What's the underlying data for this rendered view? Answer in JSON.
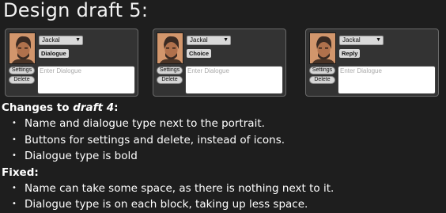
{
  "title": "Design draft 5:",
  "cards": [
    {
      "name": "Jackal",
      "dialogue_type": "Dialogue",
      "settings_label": "Settings",
      "delete_label": "Delete",
      "dialogue_placeholder": "Enter Dialogue"
    },
    {
      "name": "Jackal",
      "dialogue_type": "Choice",
      "settings_label": "Settings",
      "delete_label": "Delete",
      "dialogue_placeholder": "Enter Dialogue"
    },
    {
      "name": "Jackal",
      "dialogue_type": "Reply",
      "settings_label": "Settings",
      "delete_label": "Delete",
      "dialogue_placeholder": "Enter Dialogue"
    }
  ],
  "changes": {
    "heading_prefix": "Changes to ",
    "heading_emphasis": "draft 4",
    "heading_suffix": ":",
    "items": [
      "Name and dialogue type next to the portrait.",
      "Buttons for settings and delete, instead of icons.",
      "Dialogue type is bold"
    ]
  },
  "fixed": {
    "heading": "Fixed:",
    "items": [
      "Name can take some space, as there is nothing next to it.",
      "Dialogue type is on each block, taking up less space."
    ]
  },
  "colors": {
    "background": "#1e1e1e",
    "card": "#333333",
    "card_border": "#6a6a6a",
    "control": "#d9d9d9"
  },
  "icons": {
    "dropdown": "chevron-down-icon",
    "portrait": "character-portrait"
  }
}
